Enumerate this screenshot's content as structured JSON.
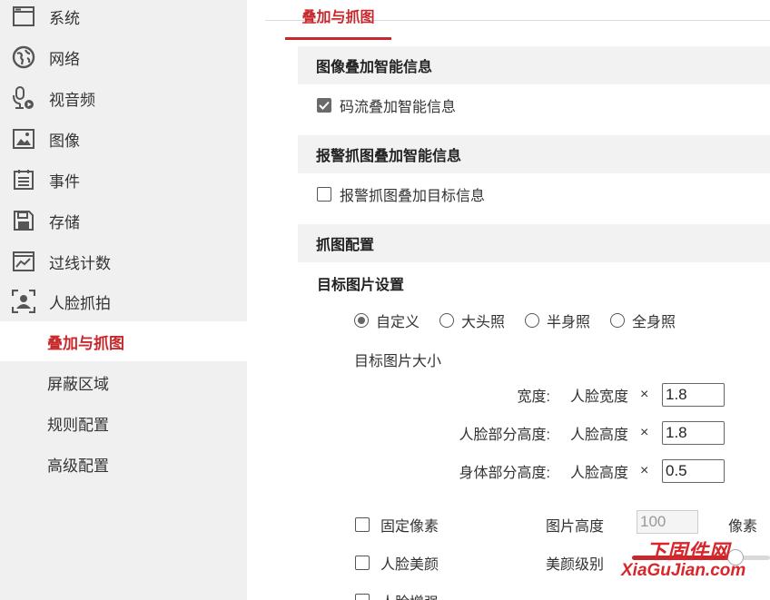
{
  "sidebar": {
    "items": [
      {
        "label": "系统",
        "icon": "system-window-icon"
      },
      {
        "label": "网络",
        "icon": "globe-icon"
      },
      {
        "label": "视音频",
        "icon": "microphone-icon"
      },
      {
        "label": "图像",
        "icon": "image-icon"
      },
      {
        "label": "事件",
        "icon": "calendar-list-icon"
      },
      {
        "label": "存储",
        "icon": "floppy-disk-icon"
      },
      {
        "label": "过线计数",
        "icon": "line-chart-icon"
      },
      {
        "label": "人脸抓拍",
        "icon": "face-capture-icon"
      }
    ],
    "subitems": [
      {
        "label": "叠加与抓图",
        "active": true
      },
      {
        "label": "屏蔽区域",
        "active": false
      },
      {
        "label": "规则配置",
        "active": false
      },
      {
        "label": "高级配置",
        "active": false
      }
    ]
  },
  "tab": {
    "label": "叠加与抓图"
  },
  "sections": {
    "overlay": {
      "title": "图像叠加智能信息",
      "checkbox_label": "码流叠加智能信息",
      "checked": true
    },
    "alarm": {
      "title": "报警抓图叠加智能信息",
      "checkbox_label": "报警抓图叠加目标信息",
      "checked": false
    },
    "capture": {
      "title": "抓图配置",
      "target_heading": "目标图片设置",
      "radio_options": [
        "自定义",
        "大头照",
        "半身照",
        "全身照"
      ],
      "selected": "自定义",
      "size_label": "目标图片大小",
      "rows": [
        {
          "label": "宽度:",
          "ref": "人脸宽度",
          "x": "×",
          "value": "1.8"
        },
        {
          "label": "人脸部分高度:",
          "ref": "人脸高度",
          "x": "×",
          "value": "1.8"
        },
        {
          "label": "身体部分高度:",
          "ref": "人脸高度",
          "x": "×",
          "value": "0.5"
        }
      ],
      "fixed_pixel": {
        "label": "固定像素",
        "height_label": "图片高度",
        "height_value": "100",
        "unit": "像素",
        "checked": false
      },
      "beauty": {
        "label": "人脸美颜",
        "level_label": "美颜级别",
        "checked": false,
        "level_fraction": 0.75
      },
      "enhance": {
        "label": "人脸增强",
        "checked": false
      }
    }
  },
  "watermark": {
    "top": "下固件网",
    "bottom": "XiaGuJian.com"
  },
  "colors": {
    "accent": "#c8282b",
    "sidebar_bg": "#f0f0f0",
    "section_bg": "#f2f2f2"
  }
}
